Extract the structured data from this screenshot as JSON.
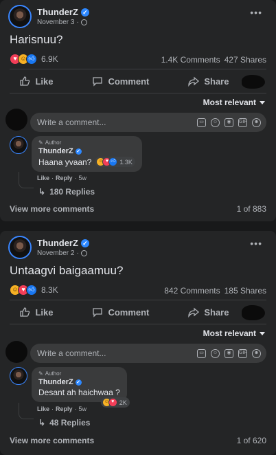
{
  "posts": [
    {
      "author": "ThunderZ",
      "date": "November 3",
      "caption": "Harisnuu?",
      "reaction_count": "6.9K",
      "comments_count": "1.4K Comments",
      "shares_count": "427 Shares",
      "actions": {
        "like": "Like",
        "comment": "Comment",
        "share": "Share"
      },
      "sort_label": "Most relevant",
      "comment_placeholder": "Write a comment...",
      "top_comment": {
        "badge": "Author",
        "name": "ThunderZ",
        "text": "Haana yvaan?",
        "reaction_count": "1.3K",
        "like_label": "Like",
        "reply_label": "Reply",
        "age": "5w"
      },
      "replies_label": "180 Replies",
      "view_more": "View more comments",
      "pager": "1 of 883"
    },
    {
      "author": "ThunderZ",
      "date": "November 2",
      "caption": "Untaagvi baigaamuu?",
      "reaction_count": "8.3K",
      "comments_count": "842 Comments",
      "shares_count": "185 Shares",
      "actions": {
        "like": "Like",
        "comment": "Comment",
        "share": "Share"
      },
      "sort_label": "Most relevant",
      "comment_placeholder": "Write a comment...",
      "top_comment": {
        "badge": "Author",
        "name": "ThunderZ",
        "text": "Desant ah haichwaa ?",
        "reaction_count": "2K",
        "like_label": "Like",
        "reply_label": "Reply",
        "age": "5w"
      },
      "replies_label": "48 Replies",
      "view_more": "View more comments",
      "pager": "1 of 620"
    }
  ],
  "colors": {
    "background": "#18191a",
    "card": "#242526",
    "accent": "#2d88ff",
    "heart": "#f33e58",
    "haha": "#f7b125"
  },
  "icons": [
    "more-dots-icon",
    "globe-icon",
    "verified-icon",
    "like-icon",
    "comment-icon",
    "share-icon",
    "pencil-icon",
    "sticker-icon",
    "emoji-icon",
    "camera-icon",
    "gif-icon",
    "reply-arrow-icon",
    "dropdown-arrow-icon"
  ]
}
